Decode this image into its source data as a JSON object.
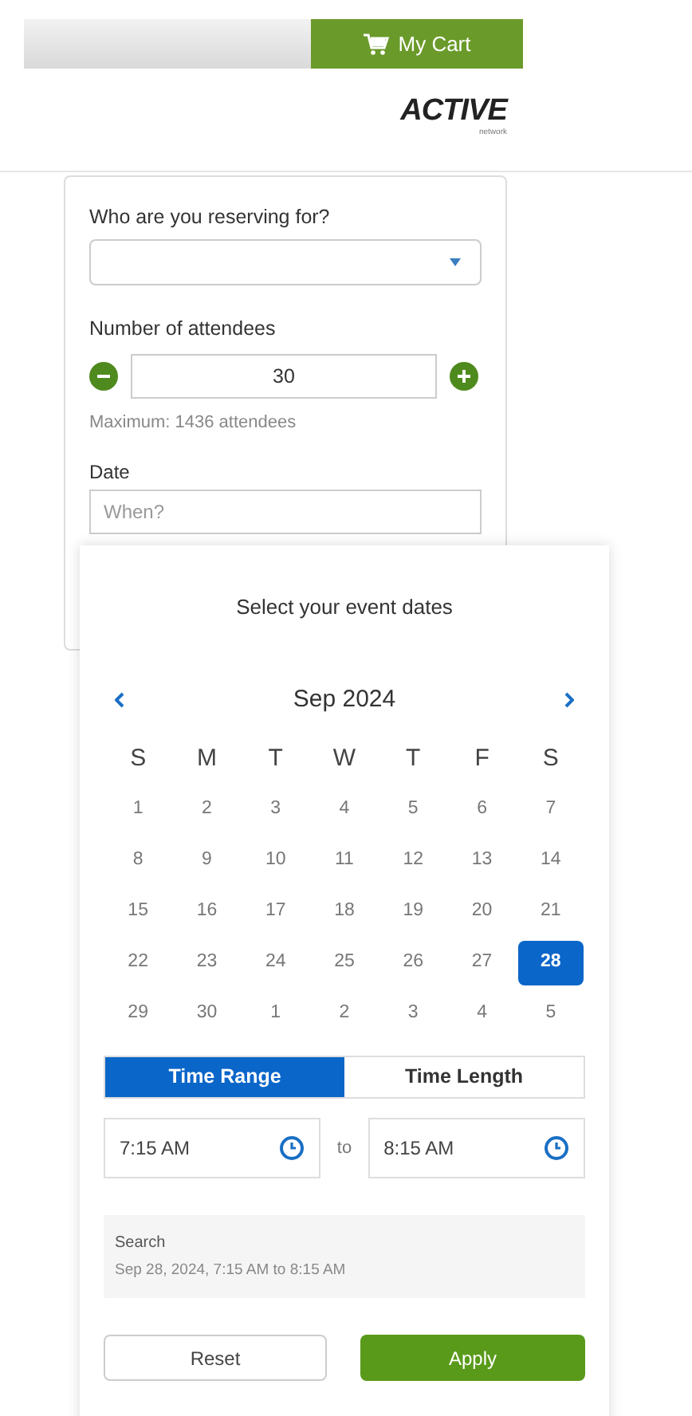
{
  "header": {
    "cart_button": "My Cart",
    "logo": {
      "text": "ACTIVE",
      "subtext": "network"
    }
  },
  "form": {
    "reserving_label": "Who are you reserving for?",
    "attendees_label": "Number of attendees",
    "attendees_value": "30",
    "attendees_note": "Maximum: 1436 attendees",
    "date_label": "Date",
    "date_placeholder": "When?"
  },
  "date_picker": {
    "title": "Select your event dates",
    "month": "Sep 2024",
    "weekdays": [
      "S",
      "M",
      "T",
      "W",
      "T",
      "F",
      "S"
    ],
    "days": [
      {
        "label": "1",
        "selected": false
      },
      {
        "label": "2",
        "selected": false
      },
      {
        "label": "3",
        "selected": false
      },
      {
        "label": "4",
        "selected": false
      },
      {
        "label": "5",
        "selected": false
      },
      {
        "label": "6",
        "selected": false
      },
      {
        "label": "7",
        "selected": false
      },
      {
        "label": "8",
        "selected": false
      },
      {
        "label": "9",
        "selected": false
      },
      {
        "label": "10",
        "selected": false
      },
      {
        "label": "11",
        "selected": false
      },
      {
        "label": "12",
        "selected": false
      },
      {
        "label": "13",
        "selected": false
      },
      {
        "label": "14",
        "selected": false
      },
      {
        "label": "15",
        "selected": false
      },
      {
        "label": "16",
        "selected": false
      },
      {
        "label": "17",
        "selected": false
      },
      {
        "label": "18",
        "selected": false
      },
      {
        "label": "19",
        "selected": false
      },
      {
        "label": "20",
        "selected": false
      },
      {
        "label": "21",
        "selected": false
      },
      {
        "label": "22",
        "selected": false
      },
      {
        "label": "23",
        "selected": false
      },
      {
        "label": "24",
        "selected": false
      },
      {
        "label": "25",
        "selected": false
      },
      {
        "label": "26",
        "selected": false
      },
      {
        "label": "27",
        "selected": false
      },
      {
        "label": "28",
        "selected": true
      },
      {
        "label": "29",
        "selected": false
      },
      {
        "label": "30",
        "selected": false
      },
      {
        "label": "1",
        "selected": false
      },
      {
        "label": "2",
        "selected": false
      },
      {
        "label": "3",
        "selected": false
      },
      {
        "label": "4",
        "selected": false
      },
      {
        "label": "5",
        "selected": false
      }
    ],
    "mode_tabs": [
      {
        "label": "Time Range",
        "selected": true
      },
      {
        "label": "Time Length",
        "selected": false
      }
    ],
    "start_time": "7:15 AM",
    "separator": "to",
    "end_time": "8:15 AM",
    "summary": {
      "label": "Search",
      "value": "Sep 28, 2024, 7:15 AM to 8:15 AM"
    },
    "buttons": {
      "reset": "Reset",
      "apply": "Apply"
    }
  }
}
